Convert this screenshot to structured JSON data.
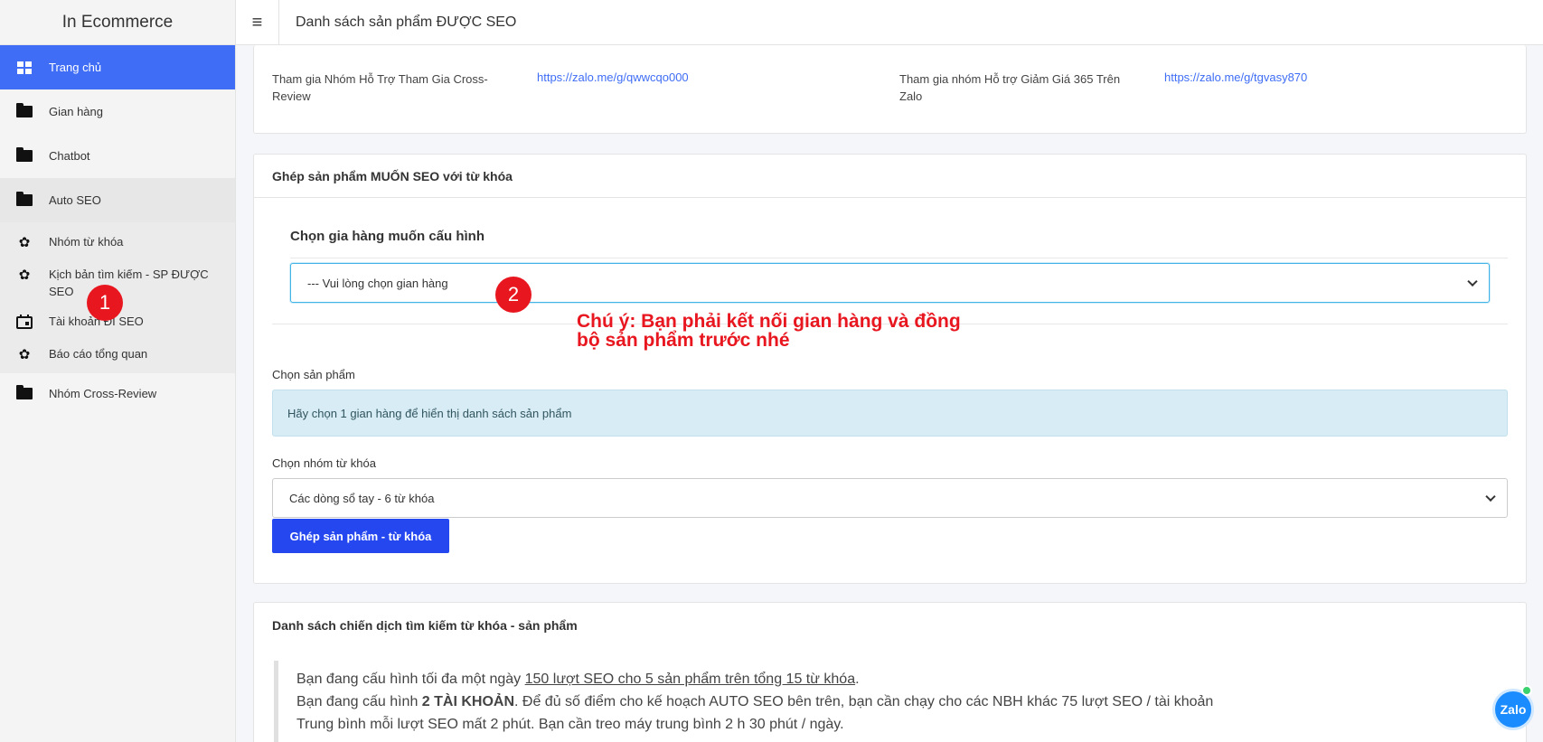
{
  "sidebar": {
    "brand": "In Ecommerce",
    "items": [
      {
        "label": "Trang chủ",
        "icon": "dashboard-icon"
      },
      {
        "label": "Gian hàng",
        "icon": "folder-icon"
      },
      {
        "label": "Chatbot",
        "icon": "folder-icon"
      },
      {
        "label": "Auto SEO",
        "icon": "folder-icon"
      },
      {
        "label": "Nhóm từ khóa",
        "icon": "gear-icon"
      },
      {
        "label": "Kịch bản tìm kiếm - SP ĐƯỢC SEO",
        "icon": "gear-icon"
      },
      {
        "label": "Tài khoản ĐI SEO",
        "icon": "calendar-icon"
      },
      {
        "label": "Báo cáo tổng quan",
        "icon": "gear-icon"
      },
      {
        "label": "Nhóm Cross-Review",
        "icon": "folder-icon"
      }
    ]
  },
  "header": {
    "title": "Danh sách sản phẩm ĐƯỢC SEO"
  },
  "groups": {
    "cross_review_label": "Tham gia Nhóm Hỗ Trợ Tham Gia Cross-Review",
    "cross_review_link": "https://zalo.me/g/qwwcqo000",
    "discount_label": "Tham gia nhóm Hỗ trợ Giảm Giá 365 Trên Zalo",
    "discount_link": "https://zalo.me/g/tgvasy870"
  },
  "match": {
    "heading": "Ghép sản phẩm MUỐN SEO với từ khóa",
    "shop_title": "Chọn gia hàng muốn cấu hình",
    "shop_select_value": "--- Vui lòng chọn gian hàng",
    "product_label": "Chọn sản phẩm",
    "product_alert": "Hãy chọn 1 gian hàng để hiển thị danh sách sản phẩm",
    "keyword_label": "Chọn nhóm từ khóa",
    "keyword_select_value": "Các dòng sổ tay - 6 từ khóa",
    "submit_label": "Ghép sản phẩm - từ khóa"
  },
  "annotations": {
    "badge1": "1",
    "badge2": "2",
    "note_line1": "Chú ý: Bạn phải kết nối gian hàng và đồng",
    "note_line2": "bộ sản phẩm trước nhé"
  },
  "campaigns": {
    "heading": "Danh sách chiến dịch tìm kiếm từ khóa - sản phẩm",
    "line1_prefix": "Bạn đang cấu hình tối đa một ngày ",
    "line1_link": "150 lượt SEO cho 5 sản phẩm trên tổng 15 từ khóa",
    "line1_suffix": ".",
    "line2_prefix": "Bạn đang cấu hình ",
    "line2_bold": "2 TÀI KHOẢN",
    "line2_suffix": ". Để đủ số điểm cho kế hoạch AUTO SEO bên trên, bạn cần chạy cho các NBH khác 75 lượt SEO / tài khoản",
    "line3": "Trung bình mỗi lượt SEO mất 2 phút. Bạn cần treo máy trung bình 2 h 30 phút / ngày."
  },
  "zalo": {
    "label": "Zalo"
  }
}
